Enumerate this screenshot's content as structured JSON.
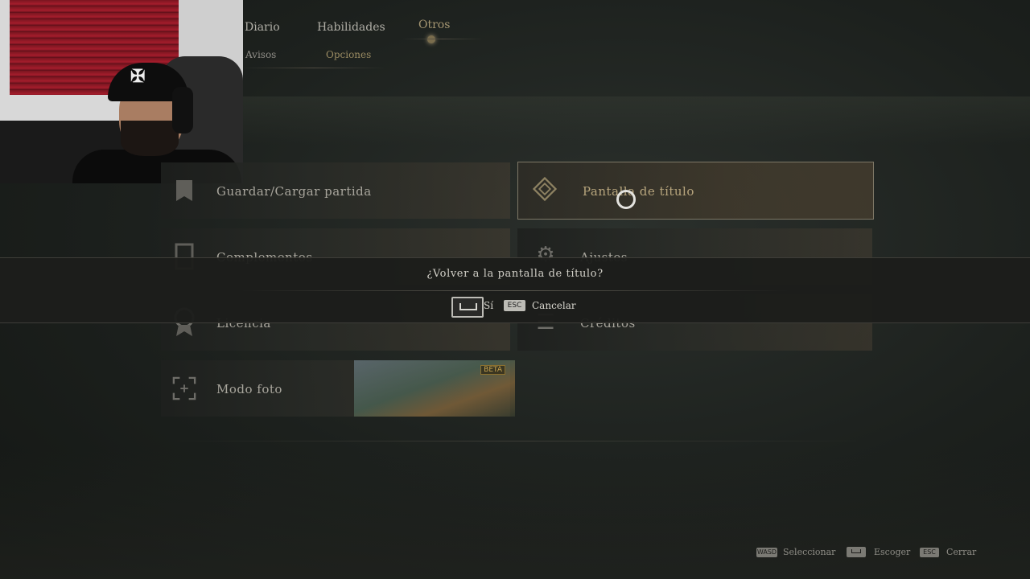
{
  "tabs": {
    "primary": [
      {
        "label": "Diario",
        "active": false
      },
      {
        "label": "Habilidades",
        "active": false
      },
      {
        "label": "Otros",
        "active": true
      }
    ],
    "secondary": [
      {
        "label": "Avisos",
        "active": false
      },
      {
        "label": "Opciones",
        "active": true
      }
    ]
  },
  "menu": {
    "items": [
      {
        "label": "Guardar/Cargar partida",
        "icon": "save-icon"
      },
      {
        "label": "Pantalla de título",
        "icon": "title-screen-icon",
        "selected": true
      },
      {
        "label": "Complementos",
        "icon": "book-icon"
      },
      {
        "label": "Ajustes",
        "icon": "gear-icon"
      },
      {
        "label": "Licencia",
        "icon": "award-ribbon-icon"
      },
      {
        "label": "Créditos",
        "icon": "credits-icon"
      },
      {
        "label": "Modo foto",
        "icon": "camera-frame-icon",
        "badge": "BETA"
      }
    ]
  },
  "dialog": {
    "title": "¿Volver a la pantalla de título?",
    "confirm_label": "Sí",
    "cancel_key": "ESC",
    "cancel_label": "Cancelar"
  },
  "footer": {
    "hints": [
      {
        "key": "WASD",
        "label": "Seleccionar"
      },
      {
        "key": "",
        "label": "Escoger"
      },
      {
        "key": "ESC",
        "label": "Cerrar"
      }
    ]
  },
  "colors": {
    "accent_gold": "#a59672",
    "background": "#1c201d",
    "text": "#c9c6bd"
  }
}
